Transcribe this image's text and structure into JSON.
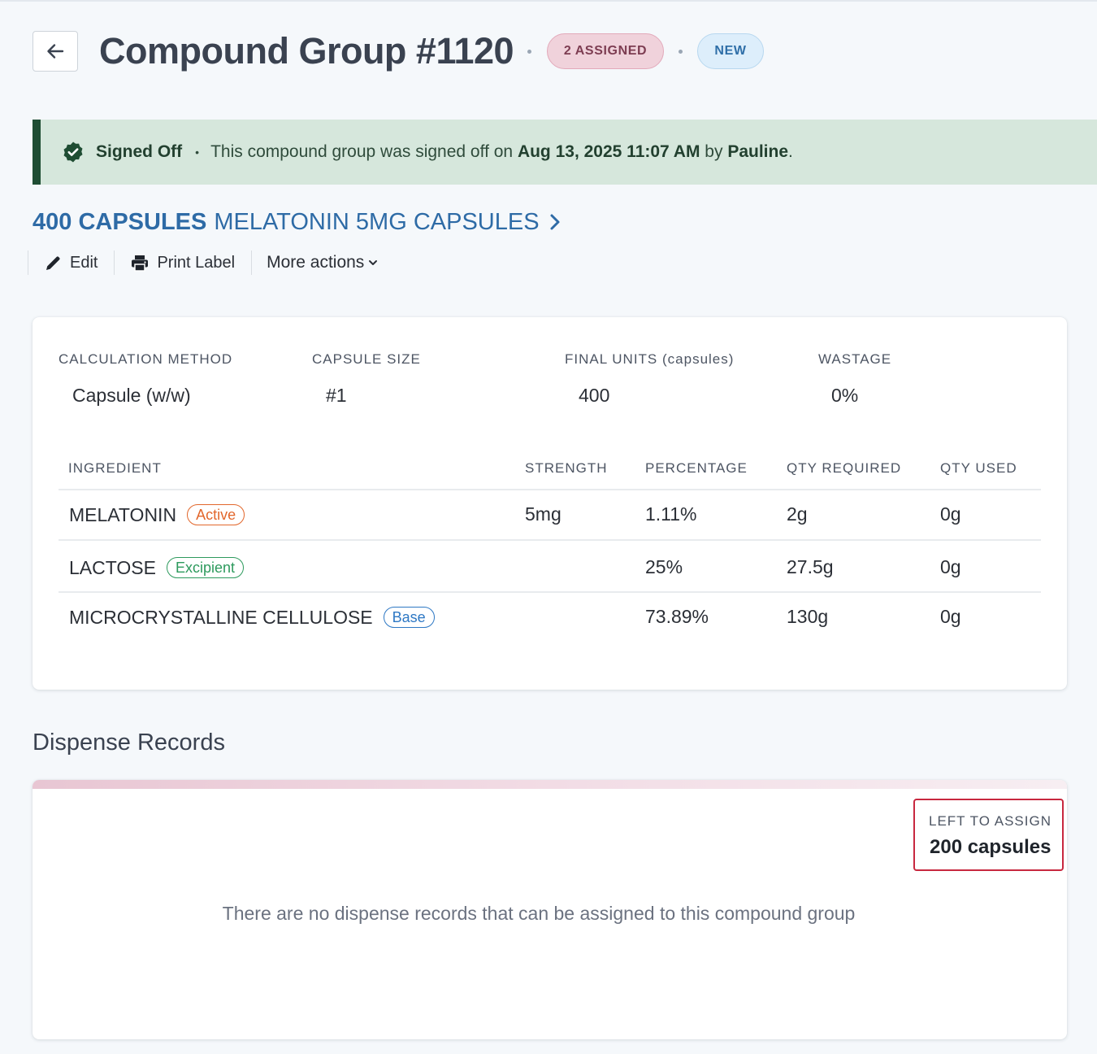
{
  "header": {
    "title": "Compound Group #1120",
    "assigned_badge": "2 ASSIGNED",
    "status_badge": "NEW"
  },
  "banner": {
    "status": "Signed Off",
    "text_prefix": "This compound group was signed off on",
    "datetime": "Aug 13, 2025 11:07 AM",
    "by_word": "by",
    "user": "Pauline",
    "period": "."
  },
  "product": {
    "quantity": "400 CAPSULES",
    "name": "MELATONIN 5MG CAPSULES"
  },
  "actions": {
    "edit": "Edit",
    "print_label": "Print Label",
    "more_actions": "More actions"
  },
  "formula": {
    "calculation_method": {
      "label": "CALCULATION METHOD",
      "value": "Capsule (w/w)"
    },
    "capsule_size": {
      "label": "CAPSULE SIZE",
      "value": "#1"
    },
    "final_units": {
      "label": "FINAL UNITS (capsules)",
      "value": "400"
    },
    "wastage": {
      "label": "WASTAGE",
      "value": "0%"
    }
  },
  "table": {
    "columns": [
      "INGREDIENT",
      "STRENGTH",
      "PERCENTAGE",
      "QTY REQUIRED",
      "QTY USED"
    ],
    "rows": [
      {
        "ingredient": "MELATONIN",
        "tag": "Active",
        "strength": "5mg",
        "percentage": "1.11%",
        "qty_required": "2g",
        "qty_used": "0g"
      },
      {
        "ingredient": "LACTOSE",
        "tag": "Excipient",
        "strength": "",
        "percentage": "25%",
        "qty_required": "27.5g",
        "qty_used": "0g"
      },
      {
        "ingredient": "MICROCRYSTALLINE CELLULOSE",
        "tag": "Base",
        "strength": "",
        "percentage": "73.89%",
        "qty_required": "130g",
        "qty_used": "0g"
      }
    ]
  },
  "dispense": {
    "title": "Dispense Records",
    "left_label": "LEFT TO ASSIGN",
    "left_value": "200 capsules",
    "empty_message": "There are no dispense records that can be assigned to this compound group"
  },
  "colors": {
    "background": "#f5f8fb",
    "banner_bg": "#d6e7dc",
    "banner_accent": "#1f4d33",
    "link_blue": "#2e6ba6",
    "assigned_pink": "#f0d2db",
    "new_blue": "#ddeefb",
    "tag_active": "#e2672c",
    "tag_excipient": "#2d9a5d",
    "tag_base": "#2e78c4",
    "left_box_border": "#c8283f"
  },
  "icons": [
    "arrow-left-icon",
    "check-badge-icon",
    "chevron-right-icon",
    "pencil-icon",
    "printer-icon",
    "chevron-down-icon"
  ]
}
